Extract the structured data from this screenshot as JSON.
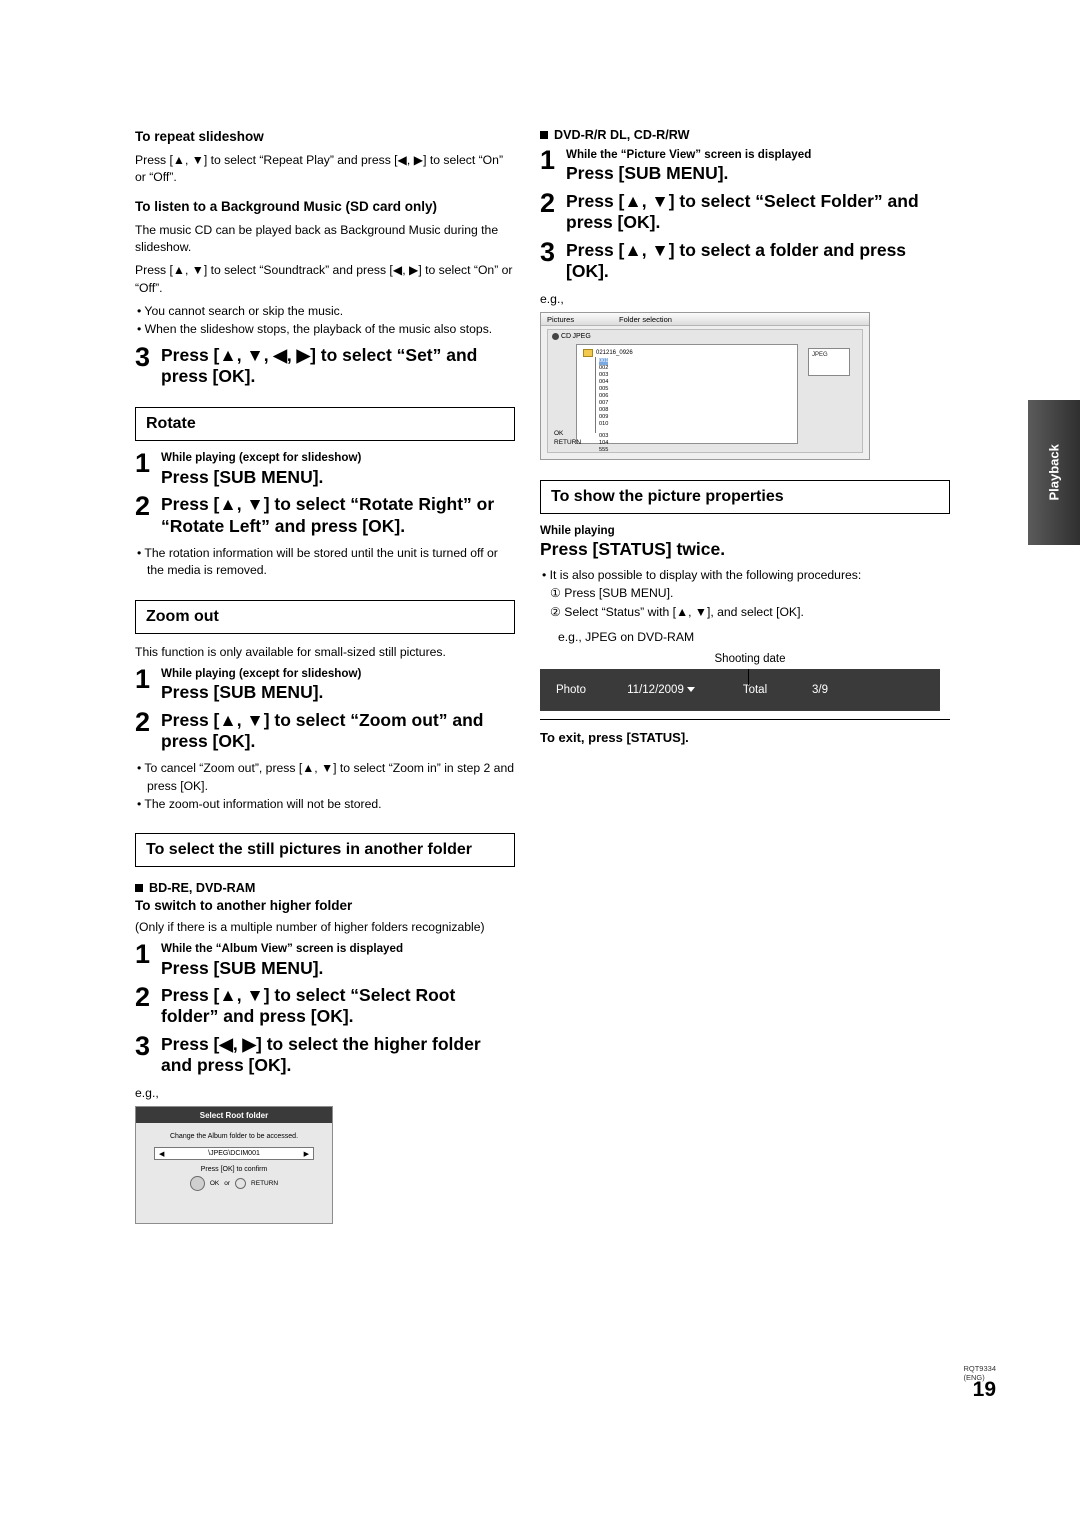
{
  "page": {
    "number": "19",
    "side_tab": "Playback",
    "footer_code_line1": "RQT9334",
    "footer_code_line2": "(ENG)"
  },
  "left": {
    "repeat_slideshow": {
      "heading": "To repeat slideshow",
      "body": "Press [▲, ▼] to select “Repeat Play” and press [◀, ▶] to select “On” or “Off”."
    },
    "bgm": {
      "heading": "To listen to a Background Music (SD card only)",
      "p1": "The music CD can be played back as Background Music during the slideshow.",
      "p2": "Press [▲, ▼] to select “Soundtrack” and press [◀, ▶] to select “On” or “Off”.",
      "bullets": [
        "You cannot search or skip the music.",
        "When the slideshow stops, the playback of the music also stops."
      ]
    },
    "step3_set": {
      "num": "3",
      "big": "Press [▲, ▼, ◀, ▶] to select “Set” and press [OK]."
    },
    "rotate": {
      "heading": "Rotate",
      "step1": {
        "num": "1",
        "cond": "While playing (except for slideshow)",
        "big": "Press [SUB MENU]."
      },
      "step2": {
        "num": "2",
        "big": "Press [▲, ▼] to select “Rotate Right” or “Rotate Left” and press [OK]."
      },
      "bullet": "The rotation information will be stored until the unit is turned off or the media is removed."
    },
    "zoomout": {
      "heading": "Zoom out",
      "intro": "This function is only available for small-sized still pictures.",
      "step1": {
        "num": "1",
        "cond": "While playing (except for slideshow)",
        "big": "Press [SUB MENU]."
      },
      "step2": {
        "num": "2",
        "big": "Press [▲, ▼] to select “Zoom out” and press [OK]."
      },
      "bullets": [
        "To cancel “Zoom out”, press [▲, ▼] to select “Zoom in” in step 2 and press [OK].",
        "The zoom-out information will not be stored."
      ]
    },
    "another_folder": {
      "heading": "To select the still pictures in another folder",
      "media": "BD-RE, DVD-RAM",
      "subheading": "To switch to another higher folder",
      "note": "(Only if there is a multiple number of higher folders recognizable)",
      "step1": {
        "num": "1",
        "cond": "While the “Album View” screen is displayed",
        "big": "Press [SUB MENU]."
      },
      "step2": {
        "num": "2",
        "big": "Press [▲, ▼] to select “Select Root folder” and press [OK]."
      },
      "step3": {
        "num": "3",
        "big": "Press [◀, ▶] to select the higher folder and press [OK]."
      },
      "eg": "e.g.,",
      "screen": {
        "title": "Select Root folder",
        "message": "Change the Album folder to be accessed.",
        "left_arrow": "◀",
        "right_arrow": "▶",
        "path": "\\JPEG\\DCIM001",
        "confirm": "Press [OK] to confirm",
        "ok_label": "OK",
        "or_label": "or",
        "return_label": "RETURN"
      }
    }
  },
  "right": {
    "media": "DVD-R/R DL, CD-R/RW",
    "step1": {
      "num": "1",
      "cond": "While the “Picture View” screen is displayed",
      "big": "Press [SUB MENU]."
    },
    "step2": {
      "num": "2",
      "big": "Press [▲, ▼] to select “Select Folder” and press [OK]."
    },
    "step3": {
      "num": "3",
      "big": "Press [▲, ▼] to select a folder and press [OK]."
    },
    "eg": "e.g.,",
    "folder_screen": {
      "tab_pictures": "Pictures",
      "tab_folder_selection": "Folder selection",
      "media_label": "CD JPEG",
      "root": "021216_0926",
      "folders": [
        "001",
        "002",
        "003",
        "004",
        "005",
        "006",
        "007",
        "008",
        "009",
        "010",
        "003",
        "104",
        "555"
      ],
      "highlight_index": 0,
      "thumb_label": "JPEG",
      "ok_label": "OK",
      "return_label": "RETURN"
    },
    "properties": {
      "heading": "To show the picture properties",
      "cond": "While playing",
      "big": "Press [STATUS] twice.",
      "bullet": "It is also possible to display with the following procedures:",
      "ol": [
        "① Press [SUB MENU].",
        "② Select “Status” with [▲, ▼], and select [OK]."
      ],
      "eg": "e.g., JPEG on DVD-RAM",
      "shooting_date_label": "Shooting date",
      "bar": {
        "photo": "Photo",
        "date": "11/12/2009",
        "total_label": "Total",
        "total_value": "3/9"
      },
      "exit": "To exit, press [STATUS]."
    }
  }
}
